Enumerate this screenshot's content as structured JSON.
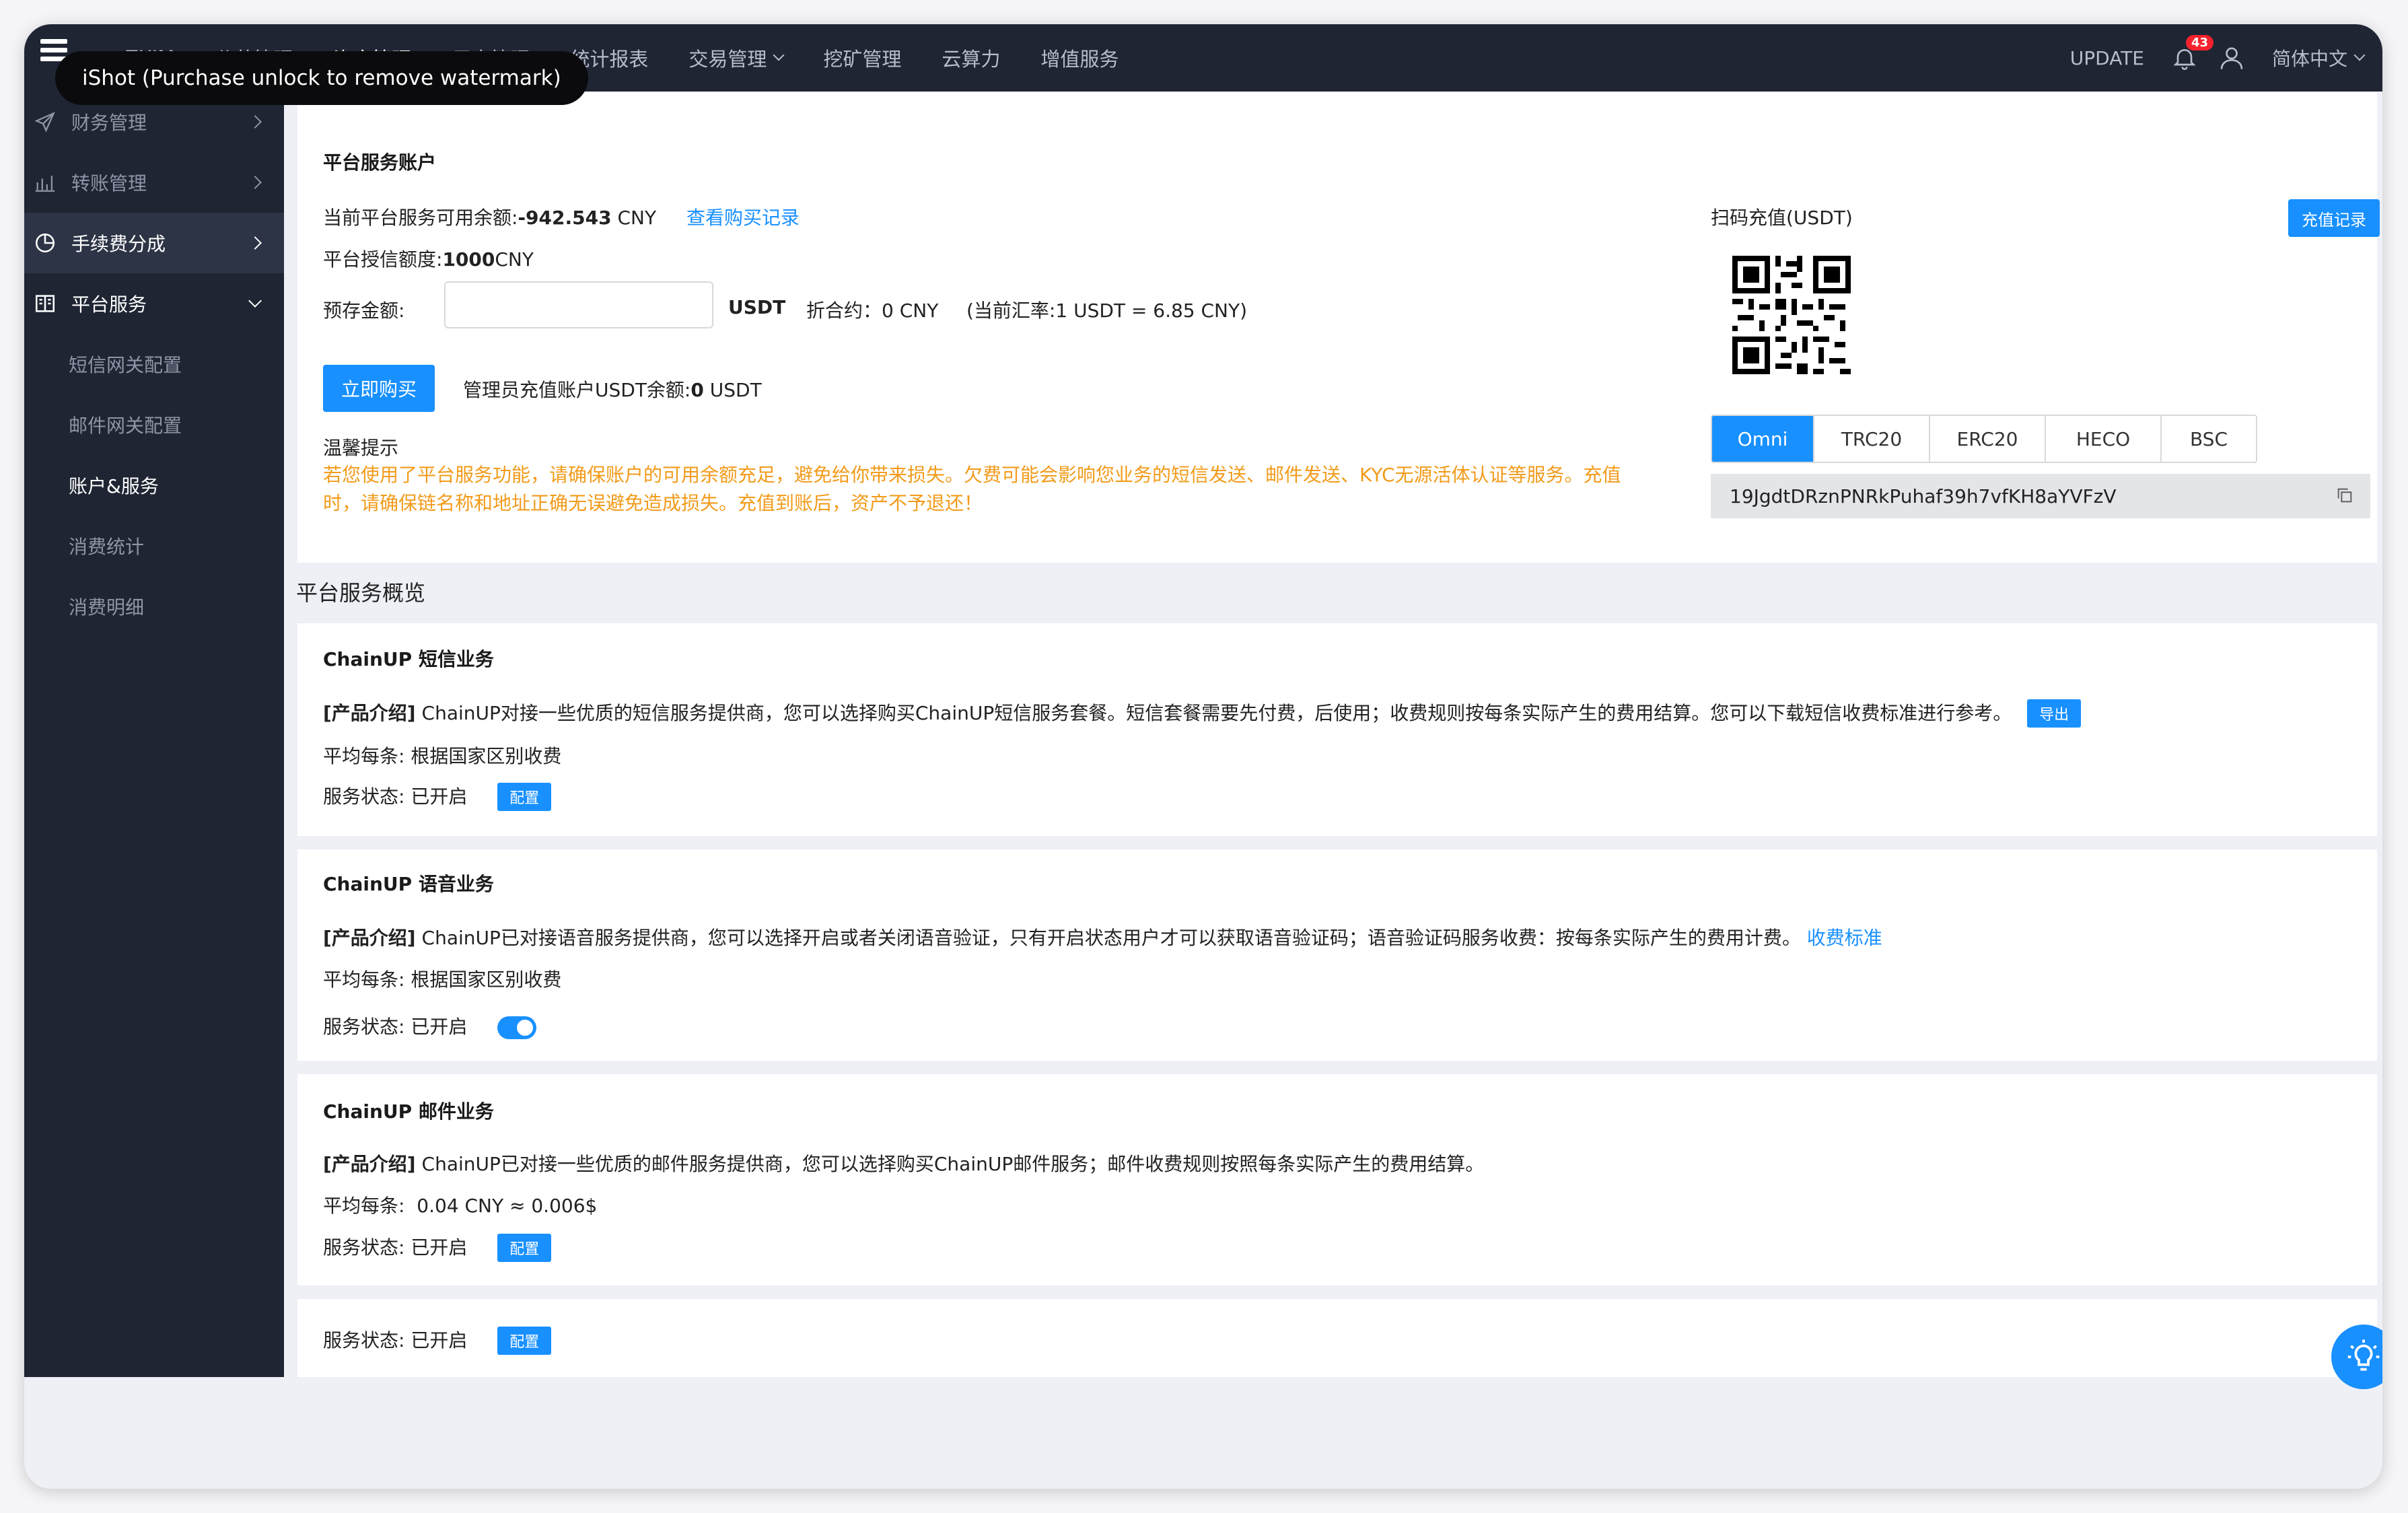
{
  "watermark": "iShot (Purchase unlock to remove watermark)",
  "topnav": {
    "items": [
      {
        "label": "ZXIM"
      },
      {
        "label": "公共管理"
      },
      {
        "label": "资产管理"
      },
      {
        "label": "用户管理"
      },
      {
        "label": "统计报表"
      },
      {
        "label": "交易管理"
      },
      {
        "label": "挖矿管理"
      },
      {
        "label": "云算力"
      },
      {
        "label": "增值服务"
      }
    ],
    "update": "UPDATE",
    "notification_count": "43",
    "language": "简体中文"
  },
  "sidebar": {
    "items": [
      {
        "label": "财务管理",
        "icon": "send-icon"
      },
      {
        "label": "转账管理",
        "icon": "bar-chart-icon"
      },
      {
        "label": "手续费分成",
        "icon": "pie-icon"
      },
      {
        "label": "平台服务",
        "icon": "book-icon"
      }
    ],
    "subitems": [
      {
        "label": "短信网关配置"
      },
      {
        "label": "邮件网关配置"
      },
      {
        "label": "账户&服务"
      },
      {
        "label": "消费统计"
      },
      {
        "label": "消费明细"
      }
    ]
  },
  "account": {
    "title": "平台服务账户",
    "balance_label": "当前平台服务可用余额:",
    "balance_value": "-942.543",
    "balance_unit": "CNY",
    "purchase_record_link": "查看购买记录",
    "credit_label": "平台授信额度:",
    "credit_value": "1000",
    "credit_unit": "CNY",
    "prestore_label": "预存金额:",
    "prestore_value": "",
    "currency": "USDT",
    "convert_text": "折合约：0 CNY",
    "rate_text": "(当前汇率:1 USDT = 6.85 CNY)",
    "buy_button": "立即购买",
    "admin_balance_label": "管理员充值账户USDT余额:",
    "admin_balance_value": "0",
    "admin_balance_unit": "USDT",
    "tip_title": "温馨提示",
    "tip_line1": "若您使用了平台服务功能，请确保账户的可用余额充足，避免给你带来损失。欠费可能会影响您业务的短信发送、邮件发送、KYC无源活体认证等服务。充值",
    "tip_line2": "时，请确保链名称和地址正确无误避免造成损失。充值到账后，资产不予退还！"
  },
  "recharge": {
    "qr_title": "扫码充值(USDT)",
    "record_button": "充值记录",
    "tabs": [
      {
        "label": "Omni"
      },
      {
        "label": "TRC20"
      },
      {
        "label": "ERC20"
      },
      {
        "label": "HECO"
      },
      {
        "label": "BSC"
      }
    ],
    "address": "19JgdtDRznPNRkPuhaf39h7vfKH8aYVFzV"
  },
  "overview": {
    "title": "平台服务概览",
    "sms": {
      "title": "ChainUP  短信业务",
      "intro_tag": "[产品介绍]",
      "intro_text": "ChainUP对接一些优质的短信服务提供商，您可以选择购买ChainUP短信服务套餐。短信套餐需要先付费，后使用；收费规则按每条实际产生的费用结算。您可以下载短信收费标准进行参考。",
      "export_button": "导出",
      "avg_label": "平均每条:",
      "avg_value": "根据国家区别收费",
      "status_label": "服务状态:",
      "status_value": "已开启",
      "config_button": "配置"
    },
    "voice": {
      "title": "ChainUP  语音业务",
      "intro_tag": "[产品介绍]",
      "intro_text": "ChainUP已对接语音服务提供商，您可以选择开启或者关闭语音验证，只有开启状态用户才可以获取语音验证码；语音验证码服务收费：按每条实际产生的费用计费。",
      "fee_link": "收费标准",
      "avg_label": "平均每条:",
      "avg_value": "根据国家区别收费",
      "status_label": "服务状态:",
      "status_value": "已开启"
    },
    "email": {
      "title": "ChainUP 邮件业务",
      "intro_tag": "[产品介绍]",
      "intro_text": "ChainUP已对接一些优质的邮件服务提供商，您可以选择购买ChainUP邮件服务；邮件收费规则按照每条实际产生的费用结算。",
      "avg_label": "平均每条:",
      "avg_value": "0.04  CNY ≈ 0.006$",
      "status_label": "服务状态:",
      "status_value": "已开启",
      "config_button": "配置"
    },
    "extra": {
      "status_label": "服务状态:",
      "status_value": "已开启",
      "config_button": "配置"
    }
  },
  "colors": {
    "primary": "#1890ff",
    "sidebar_bg": "#1f2533",
    "warning": "#f29b1a"
  }
}
